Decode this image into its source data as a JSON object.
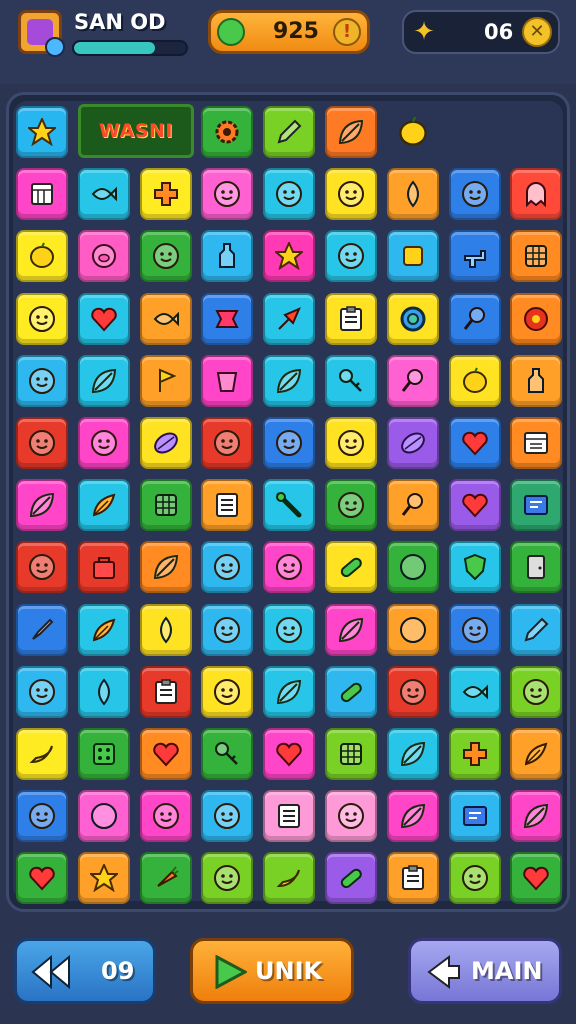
{
  "header": {
    "player_name": "SAN OD",
    "xp_progress": 0.72,
    "coins": "925",
    "gems": "06",
    "avatar_icon": "potion-avatar-icon",
    "coin_icon": "green-orb-icon",
    "gem_icon": "gold-bird-icon"
  },
  "board": {
    "banner_text": "WASNI",
    "rows": [
      [
        "#28b6f0",
        "banner",
        "banner",
        "#35b23b",
        "#7ad126",
        "#ff7a24",
        "none",
        "none",
        "none"
      ],
      [
        "#ff45c8",
        "#27c6e8",
        "#ffeb22",
        "#ff61d2",
        "#27c6e8",
        "#ffe222",
        "#ffa129",
        "#2f7fe8",
        "#ff4a3a"
      ],
      [
        "#ffeb22",
        "#ff5cc6",
        "#35b23b",
        "#2fb8f0",
        "#ff3ab4",
        "#27c6e8",
        "#2fb8f0",
        "#2f7fe8",
        "#ff8b22"
      ],
      [
        "#ffeb22",
        "#27c6e8",
        "#ffa129",
        "#2f7fe8",
        "#27c6e8",
        "#ffe222",
        "#ffe222",
        "#2f7fe8",
        "#ff8b22"
      ],
      [
        "#2fb8f0",
        "#27c6e8",
        "#ffa129",
        "#ff45c8",
        "#27c6e8",
        "#27c6e8",
        "#ff61d2",
        "#ffe222",
        "#ffa129"
      ],
      [
        "#e83a2a",
        "#ff45c8",
        "#ffe222",
        "#e83a2a",
        "#2f7fe8",
        "#ffe222",
        "#9a5ce8",
        "#2f7fe8",
        "#ff8b22"
      ],
      [
        "#ff45c8",
        "#27c6e8",
        "#35b23b",
        "#ffa129",
        "#27c6e8",
        "#35b23b",
        "#ffa129",
        "#9a5ce8",
        "#2fa870"
      ],
      [
        "#e83a2a",
        "#e83a2a",
        "#ff8b22",
        "#2fb8f0",
        "#ff45c8",
        "#ffe222",
        "#35b23b",
        "#27c6e8",
        "#35b23b"
      ],
      [
        "#2f7fe8",
        "#27c6e8",
        "#ffe222",
        "#2fb8f0",
        "#27c6e8",
        "#ff45c8",
        "#ffa129",
        "#2f7fe8",
        "#2fb8f0"
      ],
      [
        "#2fb8f0",
        "#27c6e8",
        "#e83a2a",
        "#ffe222",
        "#27c6e8",
        "#2fb8f0",
        "#e83a2a",
        "#27c6e8",
        "#7ad126"
      ],
      [
        "#ffeb22",
        "#35b23b",
        "#ff8b22",
        "#35b23b",
        "#ff45c8",
        "#7ad126",
        "#27c6e8",
        "#7ad126",
        "#ffa129"
      ],
      [
        "#2f7fe8",
        "#ff61d2",
        "#ff45c8",
        "#2fb8f0",
        "#ff9ad8",
        "#ff9ad8",
        "#ff45c8",
        "#2fb8f0",
        "#ff45c8"
      ],
      [
        "#35b23b",
        "#ffa129",
        "#35b23b",
        "#7ad126",
        "#7ad126",
        "#9a5ce8",
        "#ffa129",
        "#7ad126",
        "#35b23b"
      ]
    ],
    "icons": [
      [
        "star-icon",
        "banner",
        "banner",
        "gear-icon",
        "pencil-icon",
        "leaf-icon",
        "lemon-icon",
        "none",
        "none"
      ],
      [
        "calendar-icon",
        "fish-icon",
        "cross-icon",
        "face-icon",
        "face-icon",
        "face-icon",
        "drop-icon",
        "face-icon",
        "ghost-icon"
      ],
      [
        "lemon-icon",
        "pig-icon",
        "face-icon",
        "bottle-icon",
        "star-icon",
        "face-icon",
        "square-icon",
        "gun-icon",
        "grid-icon"
      ],
      [
        "face-icon",
        "heart-icon",
        "fish-icon",
        "ribbon-icon",
        "arrow-icon",
        "clipboard-icon",
        "ring-icon",
        "pin-icon",
        "flower-icon"
      ],
      [
        "face-icon",
        "leaf-icon",
        "flag-icon",
        "cup-icon",
        "leaf-icon",
        "key-icon",
        "pin-icon",
        "lemon-icon",
        "bottle-icon"
      ],
      [
        "face-icon",
        "face-icon",
        "seed-icon",
        "face-icon",
        "face-icon",
        "face-icon",
        "seed-icon",
        "heart-icon",
        "window-icon"
      ],
      [
        "leaf-icon",
        "feather-icon",
        "grid-icon",
        "list-icon",
        "tool-icon",
        "face-icon",
        "pin-icon",
        "heart-icon",
        "screen-icon"
      ],
      [
        "face-icon",
        "bag-icon",
        "leaf-icon",
        "face-icon",
        "face-icon",
        "pill-icon",
        "ball-icon",
        "shield-icon",
        "door-icon"
      ],
      [
        "brush-icon",
        "feather-icon",
        "drop-icon",
        "face-icon",
        "face-icon",
        "leaf-icon",
        "ball-icon",
        "face-icon",
        "pencil-icon"
      ],
      [
        "face-icon",
        "drop-icon",
        "clipboard-icon",
        "face-icon",
        "leaf-icon",
        "pill-icon",
        "face-icon",
        "fish-icon",
        "face-icon"
      ],
      [
        "banana-icon",
        "dice-icon",
        "heart-icon",
        "key-icon",
        "heart-icon",
        "grid-icon",
        "leaf-icon",
        "cross-icon",
        "feather-icon"
      ],
      [
        "face-icon",
        "ball-icon",
        "face-icon",
        "face-icon",
        "list-icon",
        "face-icon",
        "leaf-icon",
        "screen-icon",
        "leaf-icon"
      ],
      [
        "heart-icon",
        "star-icon",
        "carrot-icon",
        "face-icon",
        "banana-icon",
        "pill-icon",
        "clipboard-icon",
        "face-icon",
        "heart-icon"
      ]
    ]
  },
  "footer": {
    "back_label": "09",
    "unik_label": "UNIK",
    "main_label": "MAIN",
    "back_icon": "rewind-icon",
    "unik_icon": "play-icon",
    "main_icon": "left-arrow-icon"
  }
}
